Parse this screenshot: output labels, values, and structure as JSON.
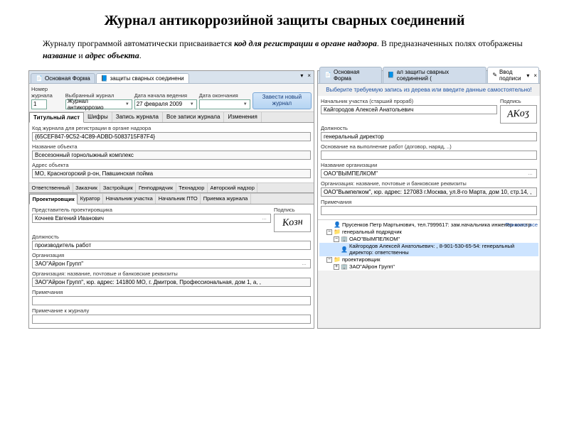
{
  "title": "Журнал антикоррозийной защиты сварных соединений",
  "desc_pre": "Журналу программой автоматически присваивается ",
  "desc_b1": "код для регистрации в органе надзора",
  "desc_mid": ". В предназначенных полях отображены ",
  "desc_b2": "название",
  "desc_mid2": " и ",
  "desc_b3": "адрес объекта",
  "desc_end": ".",
  "left": {
    "tabs": {
      "main": "Основная Форма",
      "active": "защиты сварных соединени"
    },
    "ctrl": {
      "down": "▾",
      "close": "×"
    },
    "tb": {
      "num_label": "Номер журнала",
      "num_val": "1",
      "sel_label": "Выбранный журнал",
      "sel_val": "Журнал антикоррозио",
      "start_label": "Дата начала ведения",
      "start_val": "27 февраля 2009",
      "end_label": "Дата окончания",
      "end_val": "",
      "btn": "Завести новый журнал"
    },
    "subtabs": [
      "Титульный лист",
      "Шифры",
      "Запись журнала",
      "Все записи журнала",
      "Изменения"
    ],
    "f": {
      "code_label": "Код журнала для регистрации в органе надзора",
      "code_val": "{65CEF847-9C52-4C89-ADBD-5083715F87F4}",
      "obj_label": "Название объекта",
      "obj_val": "Всесезонный горнолыжный комплекс",
      "addr_label": "Адрес объекта",
      "addr_val": "МО, Красногорский р-он, Павшинская пойма"
    },
    "roles_row1": [
      "Ответственный",
      "Заказчик",
      "Застройщик",
      "Генподрядчик",
      "Технадзор",
      "Авторский надзор"
    ],
    "roles_row2": [
      "Проектировщик",
      "Куратор",
      "Начальник участка",
      "Начальник ПТО",
      "Приемка журнала"
    ],
    "proj": {
      "rep_label": "Представитель проектировщика",
      "rep_val": "Кочнев Евгений Иванович",
      "sig_label": "Подпись",
      "pos_label": "Должность",
      "pos_val": "производитель работ",
      "org_label": "Организация",
      "org_val": "ЗАО\"Айрон Групп\"",
      "det_label": "Организация: название, почтовые и банковские реквизиты",
      "det_val": "ЗАО\"Айрон Групп\", юр. адрес: 141800 МО, г. Дмитров, Профессиональная, дом 1, а, ,",
      "notes_label": "Примечания",
      "notes_val": "",
      "jnotes_label": "Примечание к журналу",
      "jnotes_val": ""
    }
  },
  "right": {
    "tabs": {
      "main": "Основная Форма",
      "mid": "ал защиты сварных соединений (",
      "active": "Ввод подписи"
    },
    "hint": "Выберите требуемую запись из дерева или введите данные самостоятельно!",
    "f": {
      "head_label": "Начальник участка (старший прораб)",
      "head_val": "Кайгородов Алексей Анатольевич",
      "sig_label": "Подпись",
      "pos_label": "Должность",
      "pos_val": "генеральный директор",
      "basis_label": "Основание на выполнение работ (договор, наряд, ..)",
      "basis_val": "",
      "org_label": "Название организации",
      "org_val": "ОАО\"ВЫМПЕЛКОМ\"",
      "det_label": "Организация: название, почтовые и банковские реквизиты",
      "det_val": "ОАО\"Вымпелком\", юр. адрес: 127083 г.Москва, ул.8-го Марта, дом 10, стр.14, ,",
      "notes_label": "Примечания",
      "notes_val": ""
    },
    "tree": {
      "showall": "Показать все",
      "n0": "Прусенков Петр Мартынович, тел.7999617:   зам.начальника  инженер-констр",
      "n1": "генеральный подрядчик",
      "n2": "ОАО\"ВЫМПЕЛКОМ\"",
      "n3": "Кайгородов Алексей Анатольевич:  , 8-901-530-65-54:  генеральный директор:  ответственны",
      "n4": "проектировщик",
      "n5": "ЗАО\"Айрон Групп\""
    }
  }
}
